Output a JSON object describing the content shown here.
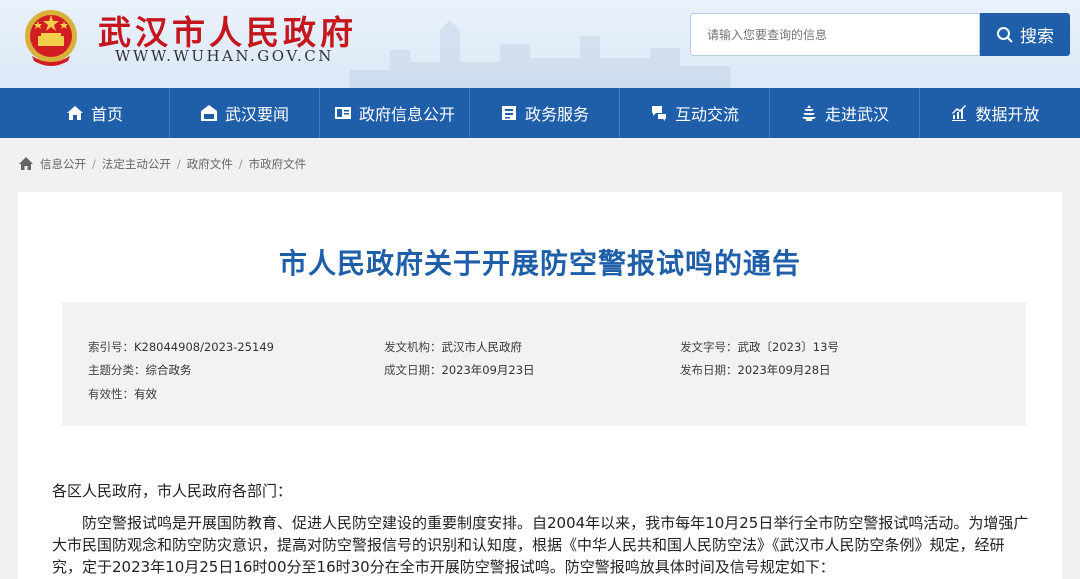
{
  "header": {
    "site_title": "武汉市人民政府",
    "site_url": "WWW.WUHAN.GOV.CN",
    "search_placeholder": "请输入您要查询的信息",
    "search_button": "搜索"
  },
  "nav": {
    "items": [
      {
        "label": "首页",
        "icon": "home-icon"
      },
      {
        "label": "武汉要闻",
        "icon": "news-icon"
      },
      {
        "label": "政府信息公开",
        "icon": "info-card-icon"
      },
      {
        "label": "政务服务",
        "icon": "service-icon"
      },
      {
        "label": "互动交流",
        "icon": "chat-icon"
      },
      {
        "label": "走进武汉",
        "icon": "pagoda-icon"
      },
      {
        "label": "数据开放",
        "icon": "chart-icon"
      }
    ]
  },
  "breadcrumb": [
    "信息公开",
    "法定主动公开",
    "政府文件",
    "市政府文件"
  ],
  "document": {
    "title": "市人民政府关于开展防空警报试鸣的通告",
    "meta": {
      "index_label": "索引号：",
      "index_value": "K28044908/2023-25149",
      "issuer_label": "发文机构：",
      "issuer_value": "武汉市人民政府",
      "doc_no_label": "发文字号：",
      "doc_no_value": "武政〔2023〕13号",
      "topic_label": "主题分类：",
      "topic_value": "综合政务",
      "created_label": "成文日期：",
      "created_value": "2023年09月23日",
      "published_label": "发布日期：",
      "published_value": "2023年09月28日",
      "validity_label": "有效性：",
      "validity_value": "有效"
    },
    "salutation": "各区人民政府，市人民政府各部门：",
    "paragraph": "防空警报试鸣是开展国防教育、促进人民防空建设的重要制度安排。自2004年以来，我市每年10月25日举行全市防空警报试鸣活动。为增强广大市民国防观念和防空防灾意识，提高对防空警报信号的识别和认知度，根据《中华人民共和国人民防空法》《武汉市人民防空条例》规定，经研究，定于2023年10月25日16时00分至16时30分在全市开展防空警报试鸣。防空警报鸣放具体时间及信号规定如下："
  },
  "colors": {
    "brand_blue": "#1f5ea8",
    "title_red": "#c4161c"
  }
}
